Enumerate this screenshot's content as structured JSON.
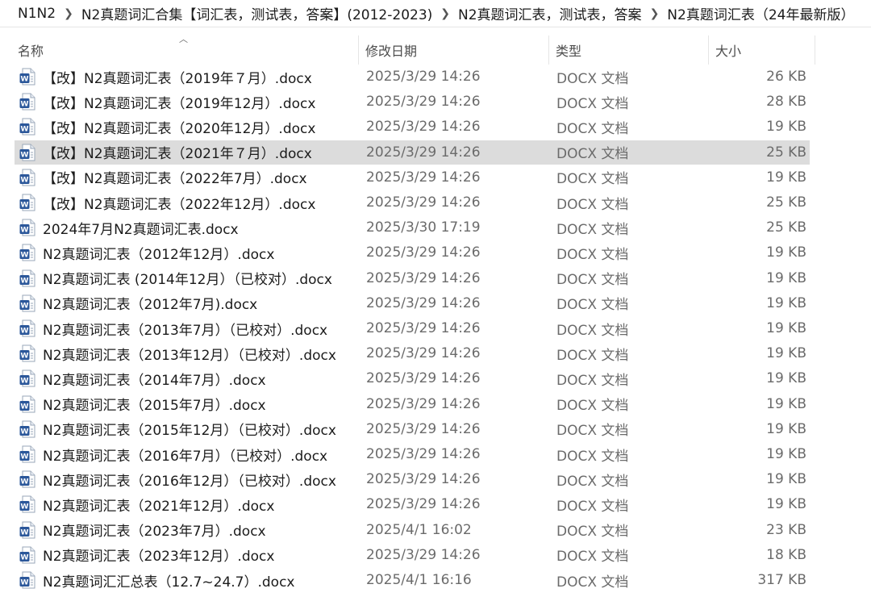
{
  "breadcrumb": [
    "N1N2",
    "N2真题词汇合集【词汇表，测试表，答案】(2012-2023)",
    "N2真题词汇表，测试表，答案",
    "N2真题词汇表（24年最新版）"
  ],
  "columns": {
    "name": "名称",
    "date": "修改日期",
    "type": "类型",
    "size": "大小"
  },
  "icons": {
    "file": "word-docx-icon",
    "separator": "chevron-right-icon",
    "sort": "sort-up-icon"
  },
  "colors": {
    "selection": "#dcdcdc",
    "word_blue": "#2b579a"
  },
  "files": [
    {
      "name": "【改】N2真题词汇表（2019年７月）.docx",
      "date": "2025/3/29 14:26",
      "type": "DOCX 文档",
      "size": "26 KB"
    },
    {
      "name": "【改】N2真题词汇表（2019年12月）.docx",
      "date": "2025/3/29 14:26",
      "type": "DOCX 文档",
      "size": "28 KB"
    },
    {
      "name": "【改】N2真题词汇表（2020年12月）.docx",
      "date": "2025/3/29 14:26",
      "type": "DOCX 文档",
      "size": "19 KB"
    },
    {
      "name": "【改】N2真题词汇表（2021年７月）.docx",
      "date": "2025/3/29 14:26",
      "type": "DOCX 文档",
      "size": "25 KB",
      "selected": true
    },
    {
      "name": "【改】N2真题词汇表（2022年7月）.docx",
      "date": "2025/3/29 14:26",
      "type": "DOCX 文档",
      "size": "19 KB"
    },
    {
      "name": "【改】N2真题词汇表（2022年12月）.docx",
      "date": "2025/3/29 14:26",
      "type": "DOCX 文档",
      "size": "25 KB"
    },
    {
      "name": "2024年7月N2真题词汇表.docx",
      "date": "2025/3/30 17:19",
      "type": "DOCX 文档",
      "size": "25 KB"
    },
    {
      "name": "N2真题词汇表（2012年12月）.docx",
      "date": "2025/3/29 14:26",
      "type": "DOCX 文档",
      "size": "19 KB"
    },
    {
      "name": "N2真题词汇表 (2014年12月）（已校对）.docx",
      "date": "2025/3/29 14:26",
      "type": "DOCX 文档",
      "size": "19 KB"
    },
    {
      "name": "N2真题词汇表（2012年7月).docx",
      "date": "2025/3/29 14:26",
      "type": "DOCX 文档",
      "size": "19 KB"
    },
    {
      "name": "N2真题词汇表（2013年7月）（已校对）.docx",
      "date": "2025/3/29 14:26",
      "type": "DOCX 文档",
      "size": "19 KB"
    },
    {
      "name": "N2真题词汇表（2013年12月）（已校对）.docx",
      "date": "2025/3/29 14:26",
      "type": "DOCX 文档",
      "size": "19 KB"
    },
    {
      "name": "N2真题词汇表（2014年7月）.docx",
      "date": "2025/3/29 14:26",
      "type": "DOCX 文档",
      "size": "19 KB"
    },
    {
      "name": "N2真题词汇表（2015年7月）.docx",
      "date": "2025/3/29 14:26",
      "type": "DOCX 文档",
      "size": "19 KB"
    },
    {
      "name": "N2真题词汇表（2015年12月）（已校对）.docx",
      "date": "2025/3/29 14:26",
      "type": "DOCX 文档",
      "size": "19 KB"
    },
    {
      "name": "N2真题词汇表（2016年7月）（已校对）.docx",
      "date": "2025/3/29 14:26",
      "type": "DOCX 文档",
      "size": "19 KB"
    },
    {
      "name": "N2真题词汇表（2016年12月）（已校对）.docx",
      "date": "2025/3/29 14:26",
      "type": "DOCX 文档",
      "size": "19 KB"
    },
    {
      "name": "N2真题词汇表（2021年12月）.docx",
      "date": "2025/3/29 14:26",
      "type": "DOCX 文档",
      "size": "19 KB"
    },
    {
      "name": "N2真题词汇表（2023年7月）.docx",
      "date": "2025/4/1 16:02",
      "type": "DOCX 文档",
      "size": "23 KB"
    },
    {
      "name": "N2真题词汇表（2023年12月）.docx",
      "date": "2025/3/29 14:26",
      "type": "DOCX 文档",
      "size": "18 KB"
    },
    {
      "name": "N2真题词汇汇总表（12.7~24.7）.docx",
      "date": "2025/4/1 16:16",
      "type": "DOCX 文档",
      "size": "317 KB"
    }
  ]
}
